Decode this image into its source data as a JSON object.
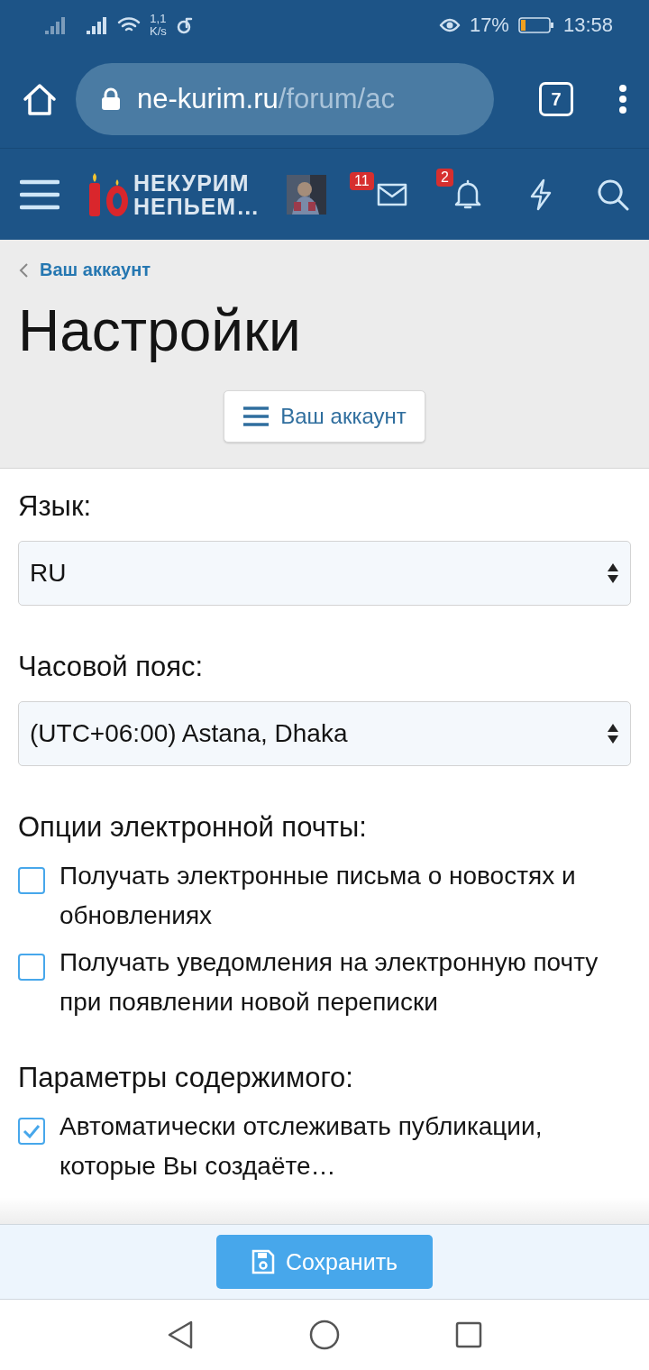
{
  "status_bar": {
    "speed": "1,1",
    "speed_unit": "K/s",
    "battery": "17%",
    "time": "13:58"
  },
  "browser": {
    "url_host": "ne-kurim.ru",
    "url_path": "/forum/ac",
    "tabs_count": "7"
  },
  "forum_header": {
    "logo_line1": "НЕКУРИМ",
    "logo_line2": "НЕПЬЕМ…",
    "messages_badge": "11",
    "alerts_badge": "2"
  },
  "breadcrumb": "Ваш аккаунт",
  "title": "Настройки",
  "account_menu_button": "Ваш аккаунт",
  "fields": [
    {
      "label": "Язык:",
      "value": "RU"
    },
    {
      "label": "Часовой пояс:",
      "value": "(UTC+06:00) Astana, Dhaka"
    }
  ],
  "groups": [
    {
      "label": "Опции электронной почты:",
      "options": [
        {
          "text": "Получать электронные письма о новостях и обновлениях",
          "checked": false
        },
        {
          "text": "Получать уведомления на электронную почту при появлении новой переписки",
          "checked": false
        }
      ]
    },
    {
      "label": "Параметры содержимого:",
      "options": [
        {
          "text": "Автоматически отслеживать публикации, которые Вы создаёте…",
          "checked": true
        }
      ]
    }
  ],
  "save_button": "Сохранить"
}
